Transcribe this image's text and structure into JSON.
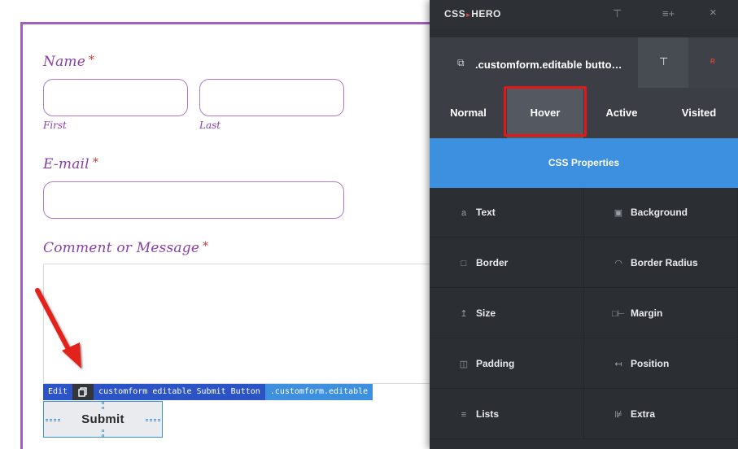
{
  "form": {
    "name_label": "Name",
    "required_mark": "*",
    "first_label": "First",
    "last_label": "Last",
    "email_label": "E-mail",
    "comment_label": "Comment or Message",
    "submit_label": "Submit"
  },
  "edit_bar": {
    "edit_label": "Edit",
    "copy_icon": "copy-icon",
    "element_path": "customform editable Submit Button",
    "class_name": ".customform.editable"
  },
  "panel": {
    "brand_left": "CSS",
    "brand_sep": "▸",
    "brand_right": "HERO",
    "header_icons": [
      "pin-icon",
      "menu-add-icon",
      "close-icon"
    ],
    "selector": ".customform.editable butto…",
    "selector_icon": "external-link-icon",
    "reset_label": "R",
    "state_tabs": [
      {
        "label": "Normal",
        "active": false
      },
      {
        "label": "Hover",
        "active": true
      },
      {
        "label": "Active",
        "active": false
      },
      {
        "label": "Visited",
        "active": false
      }
    ],
    "props_title": "CSS Properties",
    "properties": [
      {
        "label": "Text",
        "icon": "text-icon"
      },
      {
        "label": "Background",
        "icon": "background-icon"
      },
      {
        "label": "Border",
        "icon": "border-icon"
      },
      {
        "label": "Border Radius",
        "icon": "border-radius-icon"
      },
      {
        "label": "Size",
        "icon": "size-icon"
      },
      {
        "label": "Margin",
        "icon": "margin-icon"
      },
      {
        "label": "Padding",
        "icon": "padding-icon"
      },
      {
        "label": "Position",
        "icon": "position-icon"
      },
      {
        "label": "Lists",
        "icon": "lists-icon"
      },
      {
        "label": "Extra",
        "icon": "extra-icon"
      }
    ]
  },
  "colors": {
    "form_accent": "#8a3fa8",
    "panel_bg": "#2b2e33",
    "props_header": "#3d8fe0",
    "highlight": "#e01818"
  }
}
